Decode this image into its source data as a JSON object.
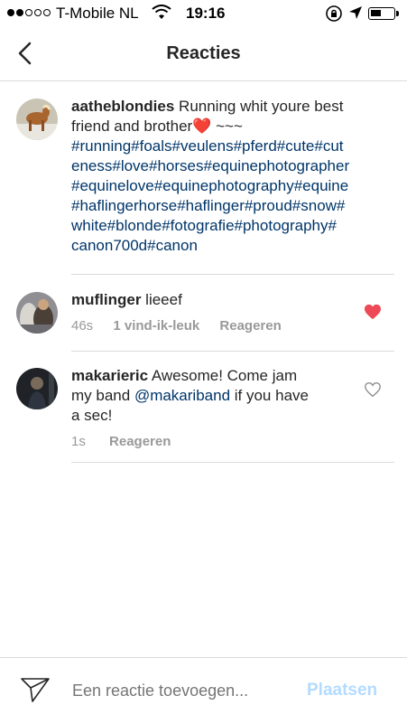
{
  "status_bar": {
    "carrier": "T-Mobile NL",
    "time": "19:16",
    "signal_dots_filled": 2,
    "signal_dots_total": 5,
    "battery_level": 0.35
  },
  "header": {
    "title": "Reacties"
  },
  "caption": {
    "username": "aatheblondies",
    "text_lines": [
      {
        "plain": " Running whit youre best",
        "tags": ""
      },
      {
        "plain": "friend and brother❤️ ~~~",
        "tags": ""
      },
      {
        "plain": "",
        "tags": "#running#foals#veulens#pferd#cute#cut"
      },
      {
        "plain": "",
        "tags": "eness#love#horses#equinephotographer"
      },
      {
        "plain": "",
        "tags": "#equinelove#equinephotography#equine"
      },
      {
        "plain": "",
        "tags": "#haflingerhorse#haflinger#proud#snow#"
      },
      {
        "plain": "",
        "tags": "white#blonde#fotografie#photography#"
      },
      {
        "plain": "",
        "tags": "canon700d#canon"
      }
    ]
  },
  "comments": [
    {
      "username": "muflinger",
      "text": " lieeef",
      "time": "46s",
      "likes": "1 vind-ik-leuk",
      "reply": "Reageren",
      "liked": true
    },
    {
      "username": "makarieric",
      "line1": " Awesome!  Come jam",
      "line2_pre": "my band ",
      "mention": "@makariband",
      "line2_post": " if you have",
      "line3": "a sec!",
      "time": "1s",
      "reply": "Reageren",
      "liked": false
    }
  ],
  "composer": {
    "placeholder": "Een reactie toevoegen...",
    "post_label": "Plaatsen"
  },
  "colors": {
    "hashtag": "#003569",
    "liked_heart": "#ed4956",
    "post_disabled": "#b3dbff"
  }
}
